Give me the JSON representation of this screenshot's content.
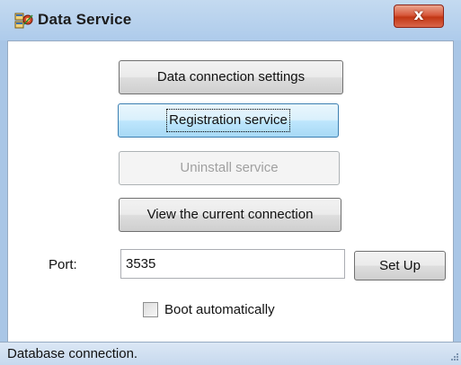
{
  "window": {
    "title": "Data Service",
    "close_glyph": "x"
  },
  "buttons": {
    "data_connection_settings": "Data connection settings",
    "registration_service": "Registration service",
    "uninstall_service": "Uninstall service",
    "view_current_connection": "View the current  connection",
    "set_up": "Set Up"
  },
  "port": {
    "label": "Port:",
    "value": "3535"
  },
  "boot": {
    "label": "Boot automatically",
    "checked": false
  },
  "status": {
    "text": "Database connection."
  },
  "icons": {
    "app": "data-service-app-icon",
    "close": "close-icon",
    "grip": "resize-grip-icon"
  },
  "colors": {
    "frame": "#a9c6e6",
    "close_button": "#c23714",
    "focus_button": "#bee6fd"
  }
}
